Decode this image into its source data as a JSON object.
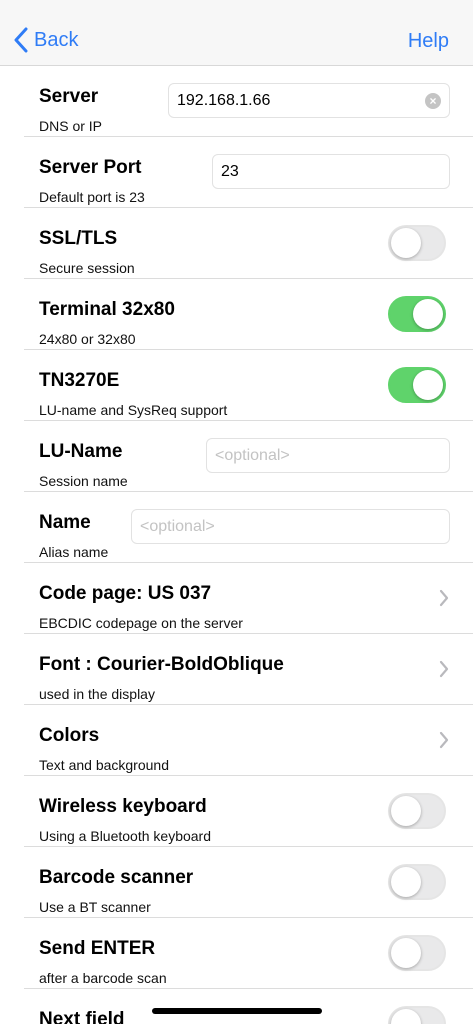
{
  "nav": {
    "back_label": "Back",
    "help_label": "Help"
  },
  "rows": [
    {
      "title": "Server",
      "subtitle": "DNS or IP",
      "control": "input",
      "value": "192.168.1.66",
      "placeholder": "",
      "clearable": true
    },
    {
      "title": "Server Port",
      "subtitle": "Default port is 23",
      "control": "input",
      "value": "23",
      "placeholder": ""
    },
    {
      "title": "SSL/TLS",
      "subtitle": "Secure session",
      "control": "toggle",
      "on": false
    },
    {
      "title": "Terminal 32x80",
      "subtitle": "24x80 or 32x80",
      "control": "toggle",
      "on": true
    },
    {
      "title": "TN3270E",
      "subtitle": "LU-name and SysReq support",
      "control": "toggle",
      "on": true
    },
    {
      "title": "LU-Name",
      "subtitle": "Session name",
      "control": "input",
      "value": "",
      "placeholder": "<optional>"
    },
    {
      "title": "Name",
      "subtitle": "Alias name",
      "control": "input",
      "value": "",
      "placeholder": "<optional>"
    },
    {
      "title": "Code page: US  037",
      "subtitle": "EBCDIC codepage on the server",
      "control": "chevron"
    },
    {
      "title": "Font : Courier-BoldOblique",
      "subtitle": "used in the display",
      "control": "chevron"
    },
    {
      "title": "Colors",
      "subtitle": "Text and background",
      "control": "chevron"
    },
    {
      "title": "Wireless keyboard",
      "subtitle": "Using a Bluetooth keyboard",
      "control": "toggle",
      "on": false
    },
    {
      "title": "Barcode scanner",
      "subtitle": "Use a BT scanner",
      "control": "toggle",
      "on": false
    },
    {
      "title": "Send ENTER",
      "subtitle": "after a barcode scan",
      "control": "toggle",
      "on": false
    },
    {
      "title": "Next field",
      "subtitle": "",
      "control": "toggle",
      "on": false
    }
  ],
  "colors": {
    "accent": "#2f7cf6",
    "toggle_on": "#5fd36b"
  }
}
